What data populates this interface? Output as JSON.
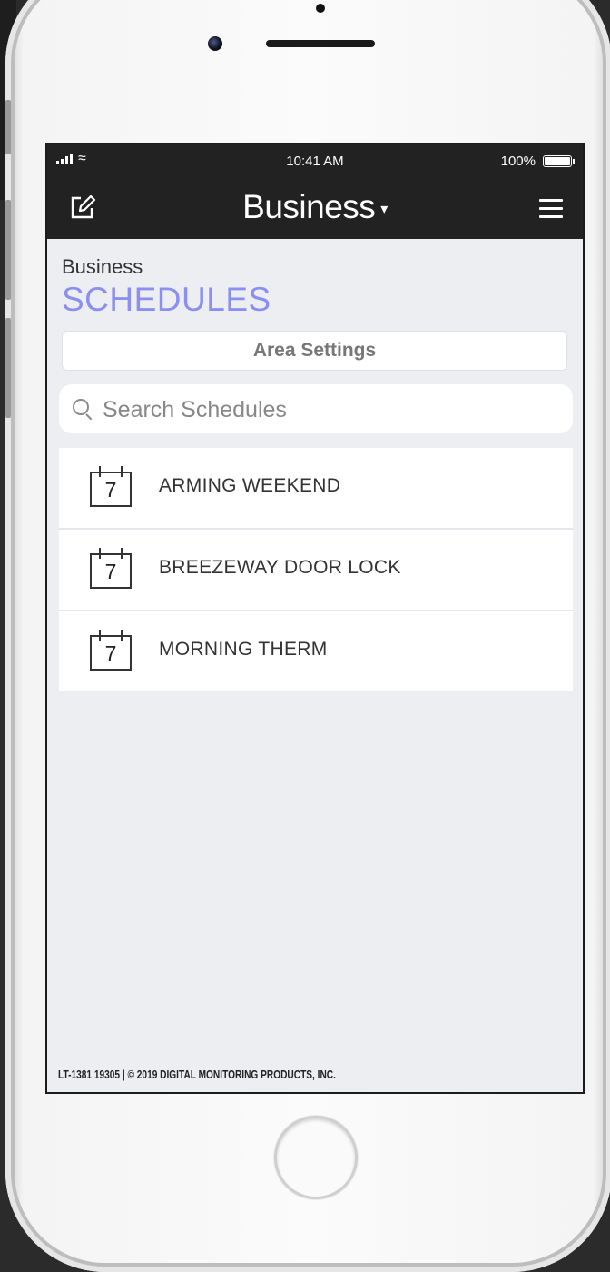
{
  "status_bar": {
    "time": "10:41 AM",
    "battery": "100%"
  },
  "nav": {
    "title": "Business",
    "caret": "▾"
  },
  "page": {
    "eyebrow": "Business",
    "heading": "SCHEDULES",
    "area_settings_label": "Area Settings"
  },
  "search": {
    "placeholder": "Search Schedules",
    "value": ""
  },
  "schedules": [
    {
      "day": "7",
      "name": "ARMING WEEKEND"
    },
    {
      "day": "7",
      "name": "BREEZEWAY DOOR LOCK"
    },
    {
      "day": "7",
      "name": "MORNING THERM"
    }
  ],
  "footer": {
    "text": "LT-1381  19305  |  © 2019 DIGITAL MONITORING PRODUCTS, INC."
  },
  "colors": {
    "accent": "#8b8ff0",
    "bar": "#222222",
    "screen_bg": "#eceef2"
  },
  "icons": [
    "signal-icon",
    "wifi-icon",
    "battery-icon",
    "edit-icon",
    "menu-icon",
    "search-icon",
    "calendar-icon"
  ]
}
